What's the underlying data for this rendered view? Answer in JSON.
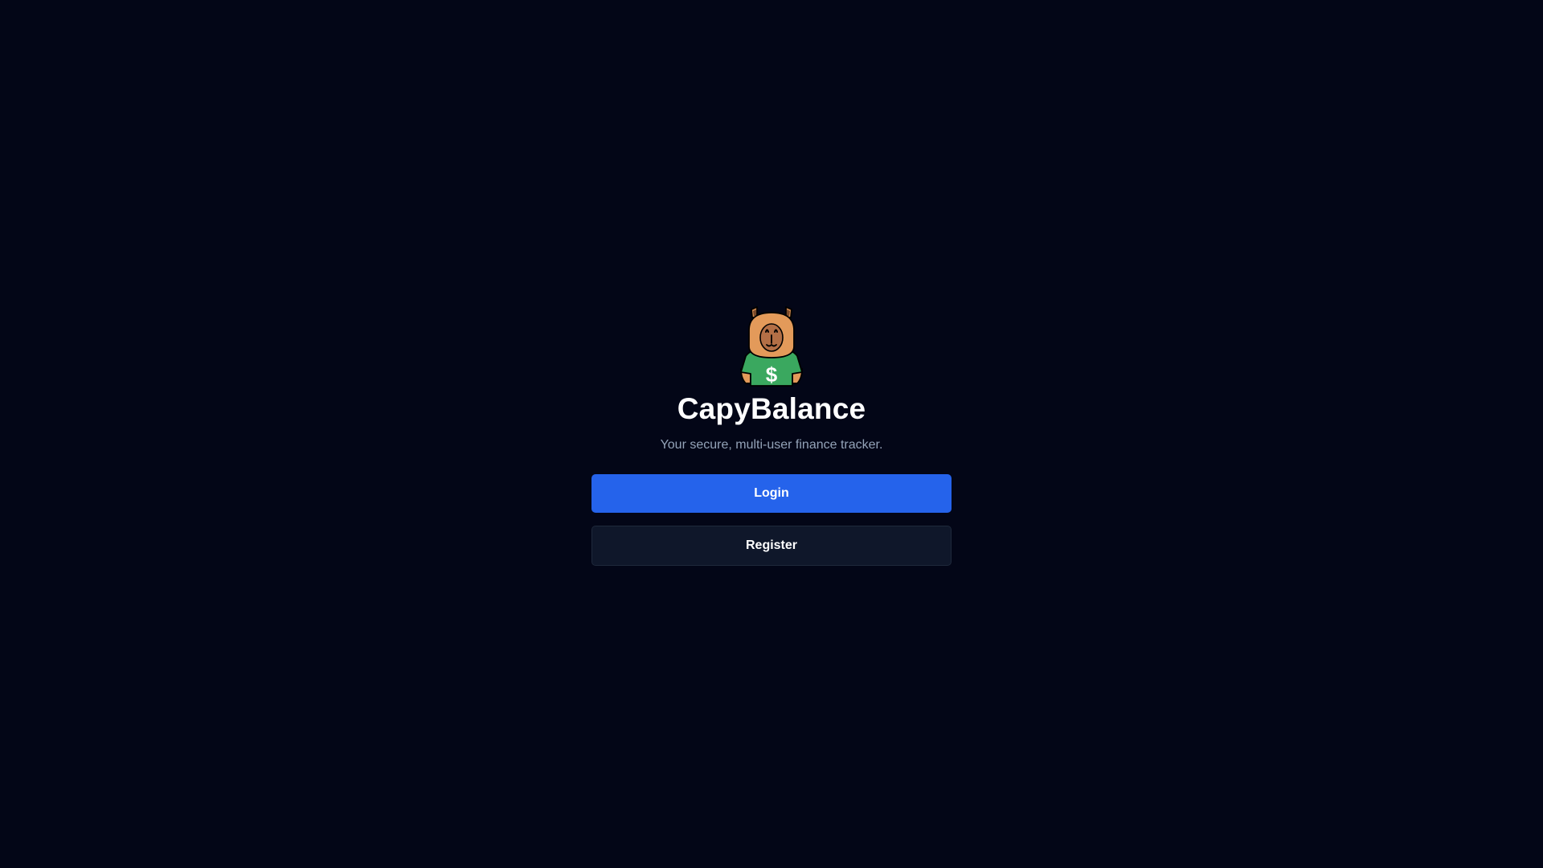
{
  "app": {
    "title": "CapyBalance",
    "tagline": "Your secure, multi-user finance tracker."
  },
  "logo": {
    "icon": "capybara-dollar-shirt-logo",
    "shirt_symbol": "$"
  },
  "actions": {
    "login_label": "Login",
    "register_label": "Register"
  },
  "colors": {
    "background": "#030617",
    "primary": "#2563eb",
    "secondary_button": "#0f172a",
    "muted_text": "#94a3b8",
    "capybara_fur": "#e39a5a",
    "shirt_green": "#3aa85f"
  }
}
